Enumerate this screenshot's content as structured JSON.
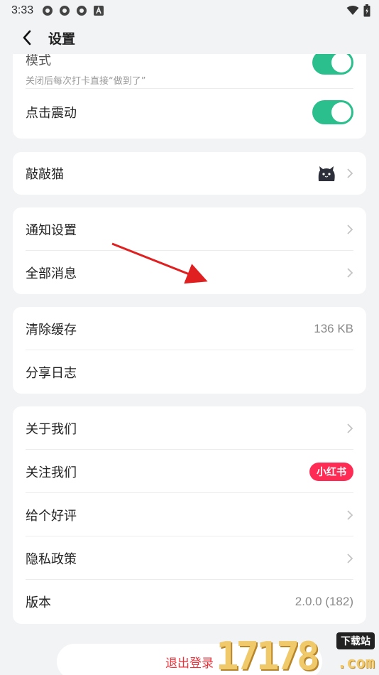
{
  "status_bar": {
    "time": "3:33"
  },
  "header": {
    "title": "设置"
  },
  "prefs": {
    "mode_label": "模式",
    "mode_sub": "关闭后每次打卡直接“做到了”",
    "vibrate_label": "点击震动"
  },
  "pet": {
    "label": "敲敲猫"
  },
  "notify": {
    "settings_label": "通知设置",
    "messages_label": "全部消息"
  },
  "cache": {
    "clear_label": "清除缓存",
    "size": "136 KB",
    "share_log_label": "分享日志"
  },
  "about": {
    "about_label": "关于我们",
    "follow_label": "关注我们",
    "follow_badge": "小红书",
    "rate_label": "给个好评",
    "privacy_label": "隐私政策",
    "version_label": "版本",
    "version_value": "2.0.0 (182)"
  },
  "logout": {
    "label": "退出登录"
  },
  "watermark": {
    "digits": "17178",
    "site": "下载站",
    "suffix": ".com"
  },
  "colors": {
    "accent": "#2bbf8e",
    "danger": "#e8343c",
    "badge": "#fe2c55",
    "arrow": "#e02020"
  }
}
